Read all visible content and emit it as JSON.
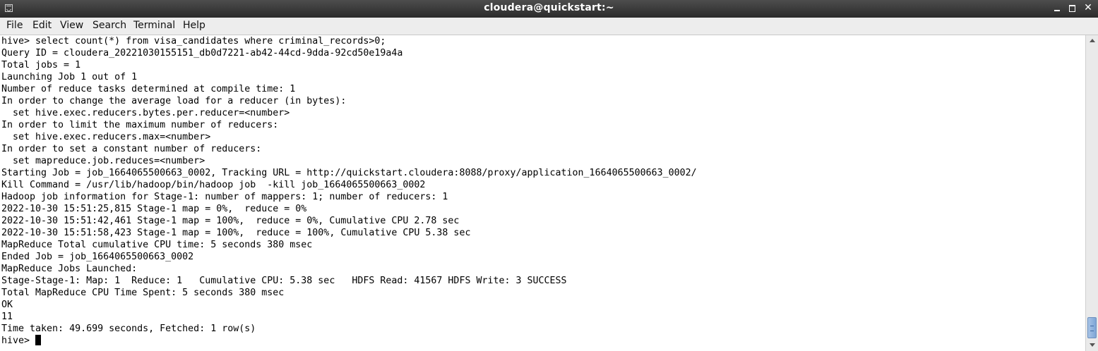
{
  "window": {
    "title": "cloudera@quickstart:~"
  },
  "menu": {
    "file": "File",
    "edit": "Edit",
    "view": "View",
    "search": "Search",
    "terminal": "Terminal",
    "help": "Help"
  },
  "terminal": {
    "lines": [
      "hive> select count(*) from visa_candidates where criminal_records>0;",
      "Query ID = cloudera_20221030155151_db0d7221-ab42-44cd-9dda-92cd50e19a4a",
      "Total jobs = 1",
      "Launching Job 1 out of 1",
      "Number of reduce tasks determined at compile time: 1",
      "In order to change the average load for a reducer (in bytes):",
      "  set hive.exec.reducers.bytes.per.reducer=<number>",
      "In order to limit the maximum number of reducers:",
      "  set hive.exec.reducers.max=<number>",
      "In order to set a constant number of reducers:",
      "  set mapreduce.job.reduces=<number>",
      "Starting Job = job_1664065500663_0002, Tracking URL = http://quickstart.cloudera:8088/proxy/application_1664065500663_0002/",
      "Kill Command = /usr/lib/hadoop/bin/hadoop job  -kill job_1664065500663_0002",
      "Hadoop job information for Stage-1: number of mappers: 1; number of reducers: 1",
      "2022-10-30 15:51:25,815 Stage-1 map = 0%,  reduce = 0%",
      "2022-10-30 15:51:42,461 Stage-1 map = 100%,  reduce = 0%, Cumulative CPU 2.78 sec",
      "2022-10-30 15:51:58,423 Stage-1 map = 100%,  reduce = 100%, Cumulative CPU 5.38 sec",
      "MapReduce Total cumulative CPU time: 5 seconds 380 msec",
      "Ended Job = job_1664065500663_0002",
      "MapReduce Jobs Launched:",
      "Stage-Stage-1: Map: 1  Reduce: 1   Cumulative CPU: 5.38 sec   HDFS Read: 41567 HDFS Write: 3 SUCCESS",
      "Total MapReduce CPU Time Spent: 5 seconds 380 msec",
      "OK",
      "11",
      "Time taken: 49.699 seconds, Fetched: 1 row(s)"
    ],
    "prompt": "hive> "
  },
  "colors": {
    "titlebar": "#3a3a3a",
    "menubar": "#ededed",
    "terminal_bg": "#ffffff",
    "terminal_fg": "#000000",
    "scroll_thumb": "#8fb0dc"
  }
}
